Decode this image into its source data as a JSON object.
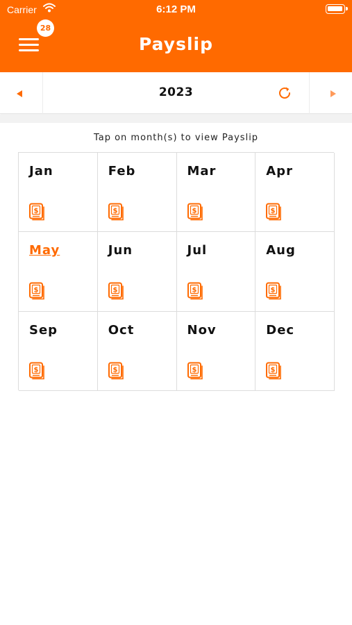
{
  "status_bar": {
    "carrier": "Carrier",
    "time": "6:12 PM"
  },
  "header": {
    "title": "Payslip",
    "notification_count": "28"
  },
  "year_selector": {
    "year": "2023"
  },
  "hint": "Tap on month(s) to view Payslip",
  "months": [
    {
      "label": "Jan",
      "current": false
    },
    {
      "label": "Feb",
      "current": false
    },
    {
      "label": "Mar",
      "current": false
    },
    {
      "label": "Apr",
      "current": false
    },
    {
      "label": "May",
      "current": true
    },
    {
      "label": "Jun",
      "current": false
    },
    {
      "label": "Jul",
      "current": false
    },
    {
      "label": "Aug",
      "current": false
    },
    {
      "label": "Sep",
      "current": false
    },
    {
      "label": "Oct",
      "current": false
    },
    {
      "label": "Nov",
      "current": false
    },
    {
      "label": "Dec",
      "current": false
    }
  ],
  "icons": {
    "menu": "hamburger-menu-icon",
    "prev": "caret-left-icon",
    "next": "caret-right-icon",
    "refresh": "refresh-icon",
    "payslip": "payslip-document-icon"
  },
  "colors": {
    "accent": "#ff6a00",
    "text": "#111111",
    "grid_line": "#dcdcdc"
  }
}
